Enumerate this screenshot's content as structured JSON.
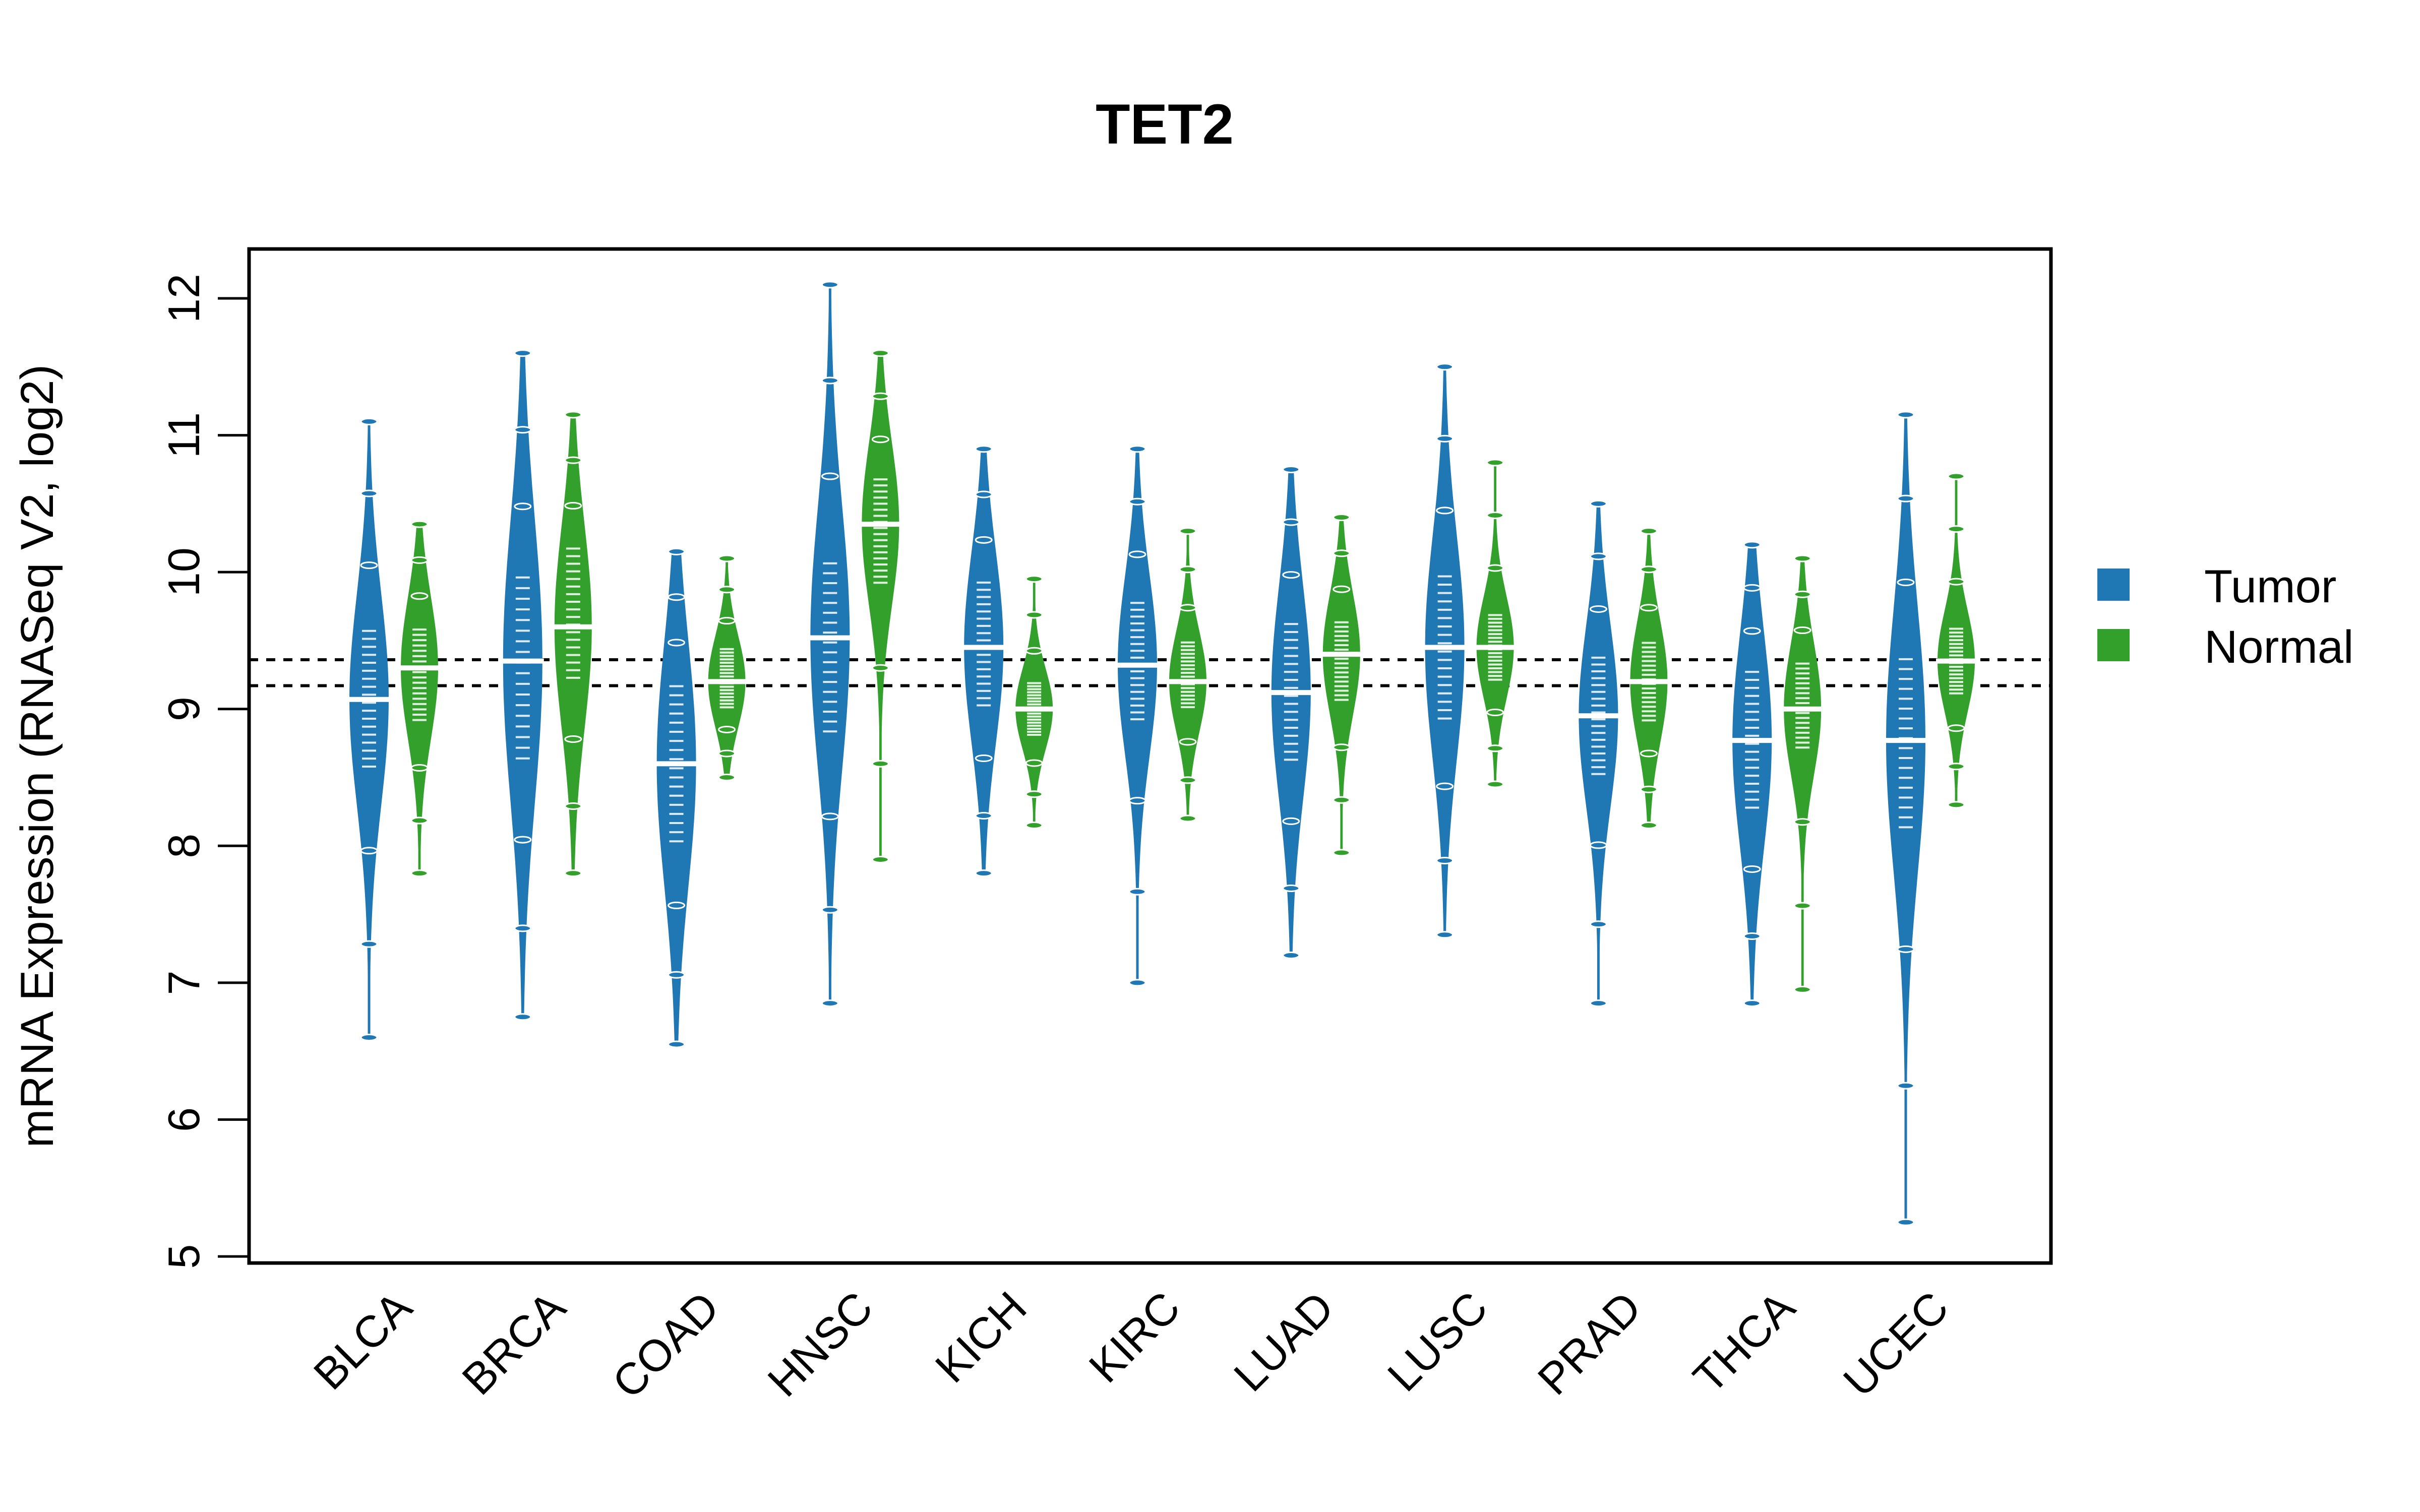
{
  "chart_data": {
    "type": "violin",
    "title": "TET2",
    "xlabel": "",
    "ylabel": "mRNA Expression (RNASeq V2, log2)",
    "ylim": [
      5,
      12.4
    ],
    "yticks": [
      5,
      6,
      7,
      8,
      9,
      10,
      11,
      12
    ],
    "grid": false,
    "legend_position": "right",
    "categories": [
      "BLCA",
      "BRCA",
      "COAD",
      "HNSC",
      "KICH",
      "KIRC",
      "LUAD",
      "LUSC",
      "PRAD",
      "THCA",
      "UCEC"
    ],
    "reference_lines": [
      9.36,
      9.17
    ],
    "series": [
      {
        "name": "Tumor",
        "color": "#1F77B4",
        "medians": [
          9.07,
          9.35,
          8.6,
          9.52,
          9.45,
          9.32,
          9.12,
          9.45,
          8.95,
          8.77,
          8.77
        ],
        "q1": [
          8.55,
          8.6,
          8.0,
          8.8,
          9.0,
          8.9,
          8.6,
          8.9,
          8.5,
          8.25,
          8.1
        ],
        "q3": [
          9.6,
          10.0,
          9.2,
          10.1,
          9.95,
          9.8,
          9.65,
          10.0,
          9.4,
          9.3,
          9.4
        ],
        "min": [
          6.6,
          6.75,
          6.55,
          6.85,
          7.8,
          7.0,
          7.2,
          7.35,
          6.85,
          6.85,
          5.25
        ],
        "max": [
          11.1,
          11.6,
          10.15,
          12.1,
          10.9,
          10.9,
          10.75,
          11.5,
          10.5,
          10.2,
          11.15
        ]
      },
      {
        "name": "Normal",
        "color": "#33A02C",
        "medians": [
          9.3,
          9.6,
          9.2,
          10.35,
          9.0,
          9.2,
          9.4,
          9.45,
          9.2,
          9.0,
          9.35
        ],
        "q1": [
          8.9,
          9.2,
          9.0,
          9.9,
          8.8,
          9.0,
          9.05,
          9.2,
          8.9,
          8.7,
          9.1
        ],
        "q3": [
          9.6,
          10.2,
          9.45,
          10.7,
          9.2,
          9.5,
          9.65,
          9.7,
          9.5,
          9.35,
          9.6
        ],
        "min": [
          7.8,
          7.8,
          8.5,
          7.9,
          8.15,
          8.2,
          7.95,
          8.45,
          8.15,
          6.95,
          8.3
        ],
        "max": [
          10.35,
          11.15,
          10.1,
          11.6,
          9.95,
          10.3,
          10.4,
          10.8,
          10.3,
          10.1,
          10.7
        ]
      }
    ]
  },
  "legend": {
    "items": [
      {
        "label": "Tumor",
        "color": "#1F77B4"
      },
      {
        "label": "Normal",
        "color": "#33A02C"
      }
    ]
  }
}
